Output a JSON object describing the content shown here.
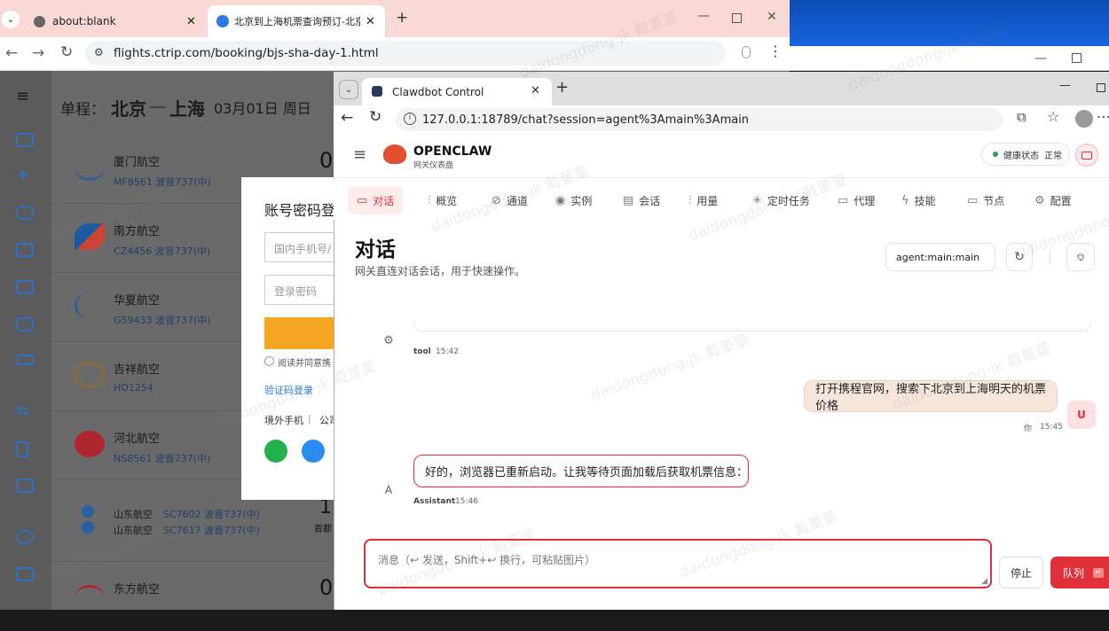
{
  "back_browser": {
    "tabs": [
      {
        "title": "about:blank"
      },
      {
        "title": "北京到上海机票查询预订-北京"
      }
    ],
    "url": "flights.ctrip.com/booking/bjs-sha-day-1.html"
  },
  "ctrip": {
    "route_prefix": "单程：",
    "from": "北京",
    "to": "上海",
    "date": "03月01日 周日",
    "flights": [
      {
        "airline": "厦门航空",
        "code": "MF8561 波音737(中)",
        "big": "0"
      },
      {
        "airline": "南方航空",
        "code": "CZ4456 波音737(中)",
        "big": ""
      },
      {
        "airline": "华夏航空",
        "code": "G59433 波音737(中)",
        "big": ""
      },
      {
        "airline": "吉祥航空",
        "code": "HO1254",
        "big": ""
      },
      {
        "airline": "河北航空",
        "code": "NS8561 波音737(中)",
        "big": ""
      },
      {
        "airline": "东方航空",
        "code": "",
        "big": "0"
      }
    ],
    "shandong": [
      {
        "airline": "山东航空",
        "code": "SC7602 波音737(中)"
      },
      {
        "airline": "山东航空",
        "code": "SC7617 波音737(中)"
      }
    ],
    "shandong_big": "1",
    "shandong_sub": "首都",
    "login": {
      "title": "账号密码登",
      "phone_placeholder": "国内手机号/",
      "password_placeholder": "登录密码",
      "agree": "阅读并同意携",
      "sms_login": "验证码登录",
      "other": "境外手机",
      "sep": "|",
      "company": "公司"
    }
  },
  "front_browser": {
    "tab_title": "Clawdbot Control",
    "url": "127.0.0.1:18789/chat?session=agent%3Amain%3Amain"
  },
  "app": {
    "brand": "OPENCLAW",
    "brand_sub": "网关仪表盘",
    "health_label": "健康状态",
    "health_value": "正常",
    "nav": [
      {
        "label": "对话",
        "icon": "chat-icon"
      },
      {
        "label": "概览",
        "icon": "chart-icon"
      },
      {
        "label": "通道",
        "icon": "link-icon"
      },
      {
        "label": "实例",
        "icon": "radio-icon"
      },
      {
        "label": "会话",
        "icon": "document-icon"
      },
      {
        "label": "用量",
        "icon": "bars-icon"
      },
      {
        "label": "定时任务",
        "icon": "loader-icon"
      },
      {
        "label": "代理",
        "icon": "folder-icon"
      },
      {
        "label": "技能",
        "icon": "bolt-icon"
      },
      {
        "label": "节点",
        "icon": "monitor-icon"
      },
      {
        "label": "配置",
        "icon": "gear-icon"
      }
    ],
    "page_title": "对话",
    "page_subtitle": "网关直连对话会话，用于快速操作。",
    "session_select": "agent:main:main",
    "messages": [
      {
        "role": "tool",
        "sender": "tool",
        "time": "15:42",
        "text": ""
      },
      {
        "role": "user",
        "sender": "你",
        "time": "15:45",
        "avatar": "U",
        "text": "打开携程官网，搜索下北京到上海明天的机票价格"
      },
      {
        "role": "assistant",
        "sender": "Assistant",
        "time": "15:46",
        "avatar": "A",
        "text": "好的，浏览器已重新启动。让我等待页面加载后获取机票信息："
      }
    ],
    "composer_placeholder": "消息（↩ 发送，Shift+↩ 换行，可粘贴图片）",
    "stop_label": "停止",
    "queue_label": "队列"
  },
  "watermark": "daidongdong-jk 戴董董",
  "colors": {
    "accent": "#e0303a",
    "back_tabbar": "#f8d9d6",
    "nav_active_bg": "#fdecec",
    "user_bubble": "#f7e6dc"
  }
}
